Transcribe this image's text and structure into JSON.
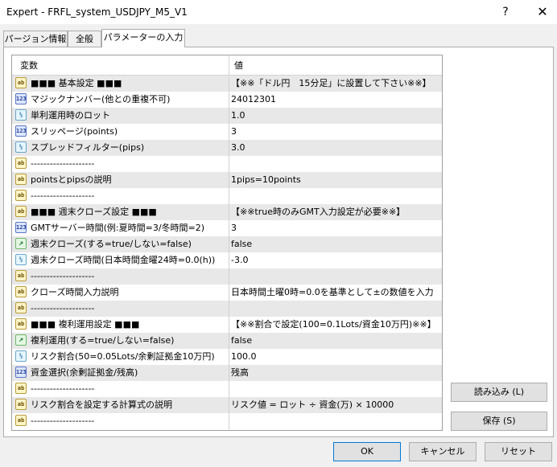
{
  "window": {
    "title": "Expert - FRFL_system_USDJPY_M5_V1",
    "help_glyph": "?",
    "close_glyph": "✕"
  },
  "tabs": [
    {
      "label": "パージョン情報",
      "active": false
    },
    {
      "label": "全般",
      "active": false
    },
    {
      "label": "パラメーターの入力",
      "active": true
    }
  ],
  "table": {
    "col_var": "変数",
    "col_val": "値",
    "rows": [
      {
        "icon": "ab",
        "name": "■■■ 基本設定 ■■■",
        "value": "【※※「ドル円　15分足」に設置して下さい※※】"
      },
      {
        "icon": "123",
        "name": "マジックナンバー(他との重複不可)",
        "value": "24012301"
      },
      {
        "icon": "v2",
        "name": "単利運用時のロット",
        "value": "1.0"
      },
      {
        "icon": "123",
        "name": "スリッページ(points)",
        "value": "3"
      },
      {
        "icon": "v2",
        "name": "スプレッドフィルター(pips)",
        "value": "3.0"
      },
      {
        "icon": "ab",
        "name": "--------------------",
        "value": ""
      },
      {
        "icon": "ab",
        "name": "pointsとpipsの説明",
        "value": "1pips=10points"
      },
      {
        "icon": "ab",
        "name": "--------------------",
        "value": ""
      },
      {
        "icon": "ab",
        "name": "■■■ 週末クローズ設定 ■■■",
        "value": "【※※true時のみGMT入力設定が必要※※】"
      },
      {
        "icon": "123",
        "name": "GMTサーバー時間(例:夏時間=3/冬時間=2)",
        "value": "3"
      },
      {
        "icon": "tf",
        "name": "週末クローズ(する=true/しない=false)",
        "value": "false"
      },
      {
        "icon": "v2",
        "name": "週末クローズ時間(日本時間金曜24時=0.0(h))",
        "value": "-3.0"
      },
      {
        "icon": "ab",
        "name": "--------------------",
        "value": ""
      },
      {
        "icon": "ab",
        "name": "クローズ時間入力説明",
        "value": "日本時間土曜0時=0.0を基準として±の数値を入力"
      },
      {
        "icon": "ab",
        "name": "--------------------",
        "value": ""
      },
      {
        "icon": "ab",
        "name": "■■■ 複利運用設定 ■■■",
        "value": "【※※割合で設定(100=0.1Lots/資金10万円)※※】"
      },
      {
        "icon": "tf",
        "name": "複利運用(する=true/しない=false)",
        "value": "false"
      },
      {
        "icon": "v2",
        "name": "リスク割合(50=0.05Lots/余剰証拠金10万円)",
        "value": "100.0"
      },
      {
        "icon": "123",
        "name": "資金選択(余剰証拠金/残高)",
        "value": "残高"
      },
      {
        "icon": "ab",
        "name": "--------------------",
        "value": ""
      },
      {
        "icon": "ab",
        "name": "リスク割合を設定する計算式の説明",
        "value": "リスク値 = ロット ÷ 資金(万) × 10000"
      },
      {
        "icon": "ab",
        "name": "--------------------",
        "value": ""
      }
    ]
  },
  "side_buttons": {
    "load": "読み込み (L)",
    "save": "保存 (S)"
  },
  "bottom_buttons": {
    "ok": "OK",
    "cancel": "キャンセル",
    "reset": "リセット"
  },
  "icon_labels": {
    "ab": "ab",
    "123": "123",
    "v2": "½",
    "tf": "↗"
  }
}
